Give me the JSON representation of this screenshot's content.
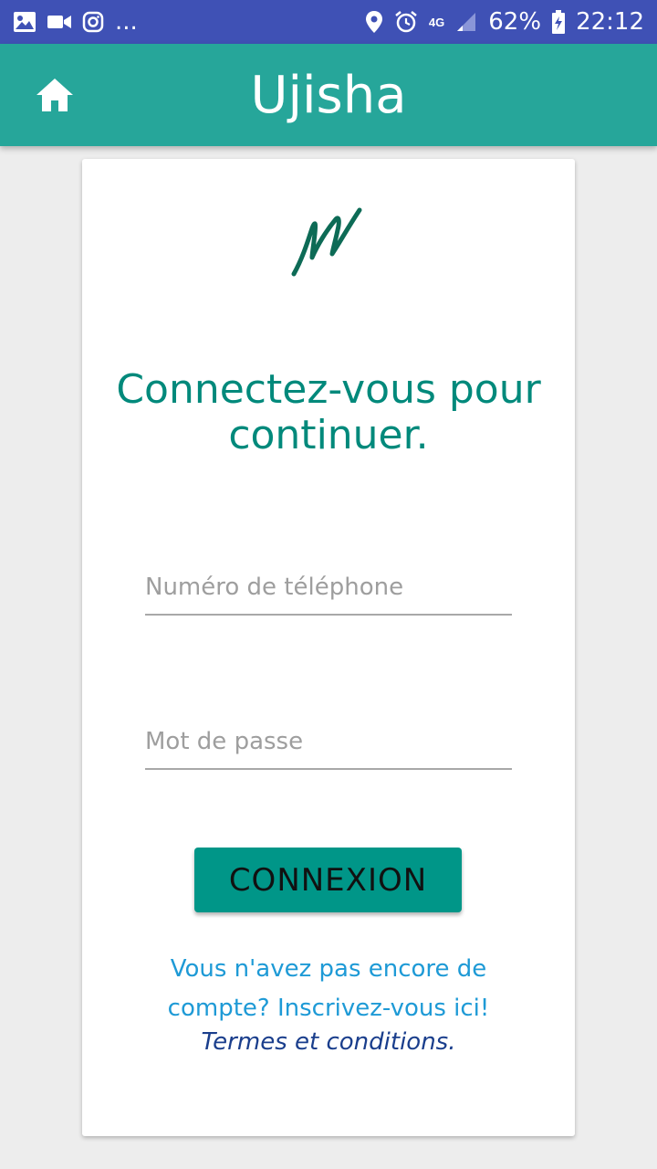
{
  "status_bar": {
    "notification_icons": [
      "image-icon",
      "video-icon",
      "instagram-icon"
    ],
    "overflow": "...",
    "network": "4G",
    "battery": "62%",
    "time": "22:12",
    "system_icons": [
      "location-icon",
      "alarm-icon",
      "signal-icon",
      "battery-charging-icon"
    ]
  },
  "app_bar": {
    "title": "Ujisha",
    "home_icon": "home-icon"
  },
  "login": {
    "logo_icon": "signature-m-logo",
    "heading_line1": "Connectez-vous pour",
    "heading_line2": "continuer.",
    "phone_placeholder": "Numéro de téléphone",
    "phone_value": "",
    "password_placeholder": "Mot de passe",
    "password_value": "",
    "submit_label": "CONNEXION",
    "signup_line1": "Vous n'avez pas encore de",
    "signup_line2": "compte? Inscrivez-vous ici!",
    "terms_label": "Termes et conditions."
  },
  "colors": {
    "status_bar": "#3f51b5",
    "app_bar": "#26a69a",
    "accent": "#009688",
    "heading": "#00897b",
    "link": "#1e9ad6",
    "terms": "#1a3e8c",
    "background": "#ededed"
  }
}
